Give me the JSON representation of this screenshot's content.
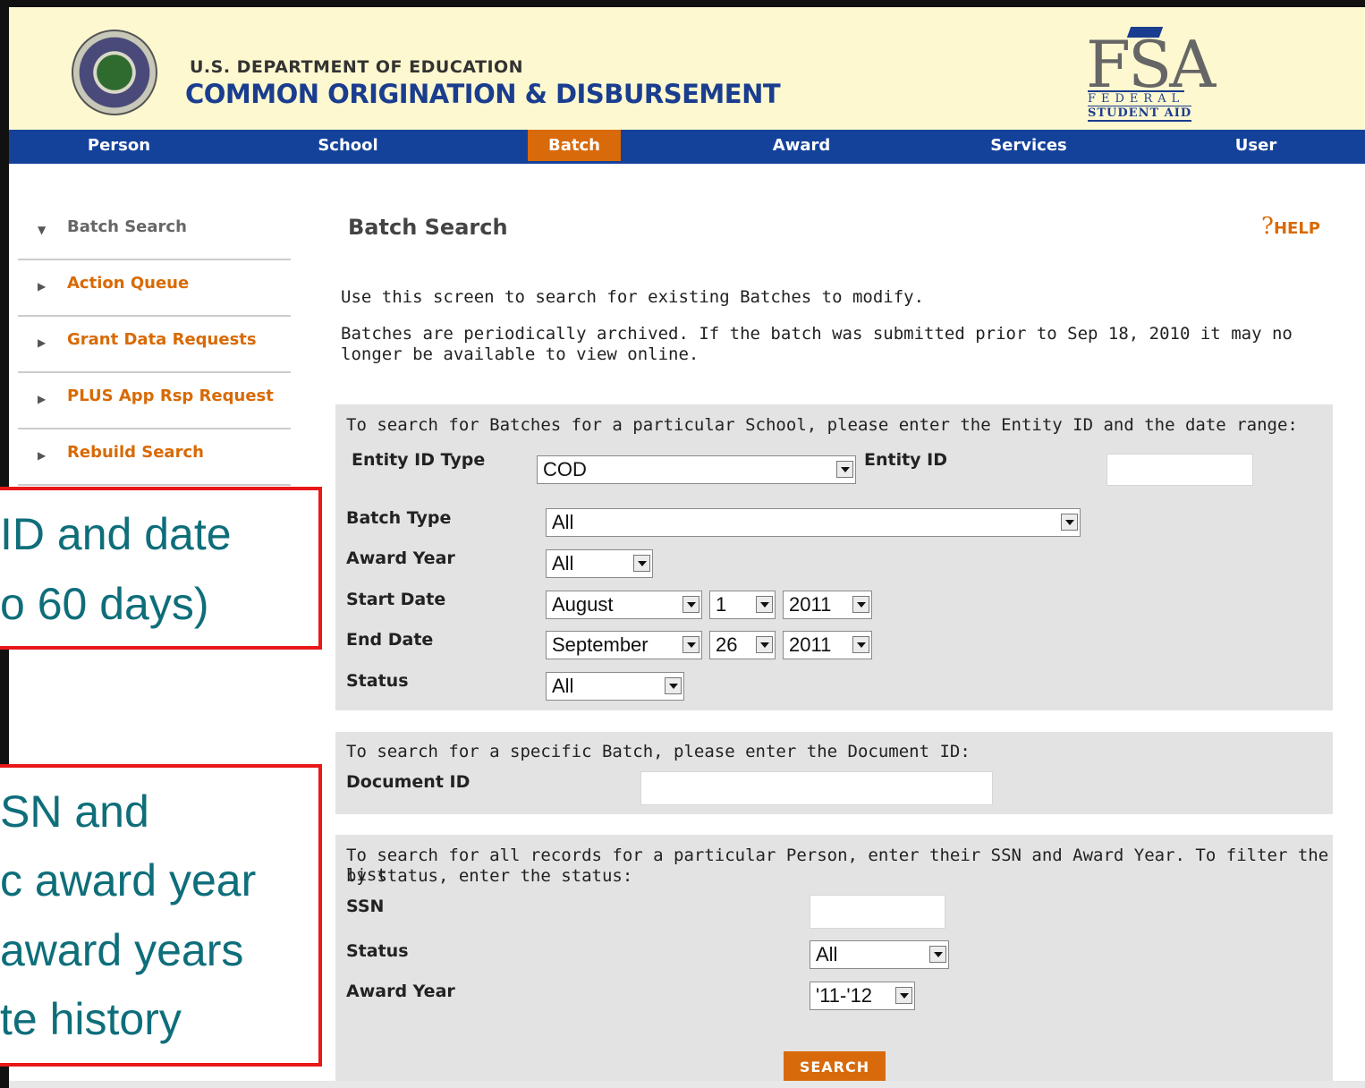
{
  "header": {
    "dept": "U.S. DEPARTMENT OF EDUCATION",
    "system": "COMMON ORIGINATION & DISBURSEMENT",
    "logo_big": "FSA",
    "logo_line1": "FEDERAL",
    "logo_line2": "STUDENT AID"
  },
  "nav": {
    "items": [
      "Person",
      "School",
      "Batch",
      "Award",
      "Services",
      "User"
    ],
    "active": "Batch",
    "active_color": "#d96a0b",
    "bar_color": "#14429b"
  },
  "sidebar": {
    "items": [
      {
        "label": "Batch Search",
        "current": true
      },
      {
        "label": "Action Queue"
      },
      {
        "label": "Grant Data Requests"
      },
      {
        "label": "PLUS App Rsp Request"
      },
      {
        "label": "Rebuild Search"
      }
    ]
  },
  "main": {
    "title": "Batch Search",
    "help": "HELP",
    "intro1": "Use this screen to search for existing Batches to modify.",
    "intro2a": "Batches are periodically archived. If the batch was submitted prior to Sep 18, 2010 it may no",
    "intro2b": "longer be available to view online."
  },
  "panel1": {
    "instruction": "To search for Batches for a particular School, please enter the Entity ID and the date range:",
    "entity_id_type_label": "Entity ID Type",
    "entity_id_type_value": "COD",
    "entity_id_label": "Entity ID",
    "entity_id_value": "",
    "batch_type_label": "Batch Type",
    "batch_type_value": "All",
    "award_year_label": "Award Year",
    "award_year_value": "All",
    "start_date_label": "Start Date",
    "start_month": "August",
    "start_day": "1",
    "start_year": "2011",
    "end_date_label": "End Date",
    "end_month": "September",
    "end_day": "26",
    "end_year": "2011",
    "status_label": "Status",
    "status_value": "All"
  },
  "panel2": {
    "instruction": "To search for a specific Batch, please enter the Document ID:",
    "document_id_label": "Document ID",
    "document_id_value": ""
  },
  "panel3": {
    "instruction_a": "To search for all records for a particular Person, enter their SSN and Award Year. To filter the list",
    "instruction_b": "by status, enter the status:",
    "ssn_label": "SSN",
    "ssn_value": "",
    "status_label": "Status",
    "status_value": "All",
    "award_year_label": "Award Year",
    "award_year_value": "'11-'12"
  },
  "search_button": "SEARCH",
  "callout1": {
    "lines": [
      "ID and date",
      "o 60 days)"
    ]
  },
  "callout2": {
    "lines": [
      "SN and",
      "c award year",
      "award years",
      "te history"
    ]
  }
}
